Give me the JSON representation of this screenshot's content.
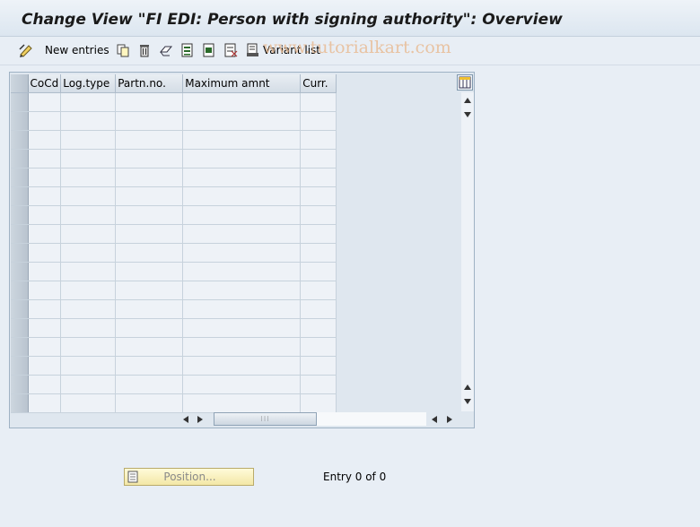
{
  "window": {
    "title": "Change View \"FI EDI: Person with signing authority\": Overview"
  },
  "toolbar": {
    "items": [
      {
        "icon": "display-change-icon"
      },
      {
        "label": "New entries"
      },
      {
        "icon": "copy-icon"
      },
      {
        "icon": "delete-icon"
      },
      {
        "icon": "undo-change-icon"
      },
      {
        "icon": "select-all-icon"
      },
      {
        "icon": "select-block-icon"
      },
      {
        "icon": "deselect-all-icon"
      },
      {
        "icon": "variant-list-icon",
        "label": "Variant list"
      }
    ]
  },
  "watermark": "www.tutorialkart.com",
  "table": {
    "columns": [
      "CoCd",
      "Log.type",
      "Partn.no.",
      "Maximum amnt",
      "Curr."
    ],
    "rows": 17,
    "config_icon": "table-settings-icon"
  },
  "footer": {
    "position_button": "Position...",
    "entry_info": "Entry 0 of 0"
  }
}
